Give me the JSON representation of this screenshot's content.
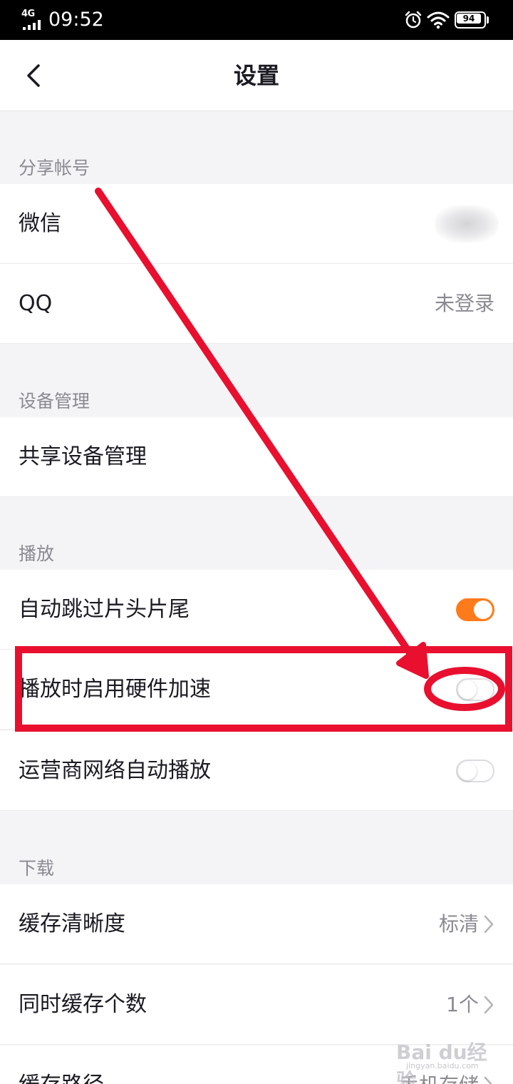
{
  "status_bar": {
    "network": "4G",
    "time": "09:52",
    "battery": "94",
    "icons": [
      "signal-icon",
      "alarm-icon",
      "wifi-icon",
      "battery-icon"
    ]
  },
  "header": {
    "title": "设置",
    "back_icon": "chevron-left-icon"
  },
  "sections": {
    "share": {
      "label": "分享帐号",
      "items": [
        {
          "label": "微信",
          "value": ""
        },
        {
          "label": "QQ",
          "value": "未登录"
        }
      ]
    },
    "device": {
      "label": "设备管理",
      "items": [
        {
          "label": "共享设备管理"
        }
      ]
    },
    "playback": {
      "label": "播放",
      "items": [
        {
          "label": "自动跳过片头片尾",
          "enabled": true
        },
        {
          "label": "播放时启用硬件加速",
          "enabled": false
        },
        {
          "label": "运营商网络自动播放",
          "enabled": false
        }
      ]
    },
    "download": {
      "label": "下载",
      "items": [
        {
          "label": "缓存清晰度",
          "value": "标清"
        },
        {
          "label": "同时缓存个数",
          "value": "1个"
        },
        {
          "label": "缓存路径",
          "value": "手机存储"
        }
      ]
    }
  },
  "colors": {
    "accent": "#ff7a1a",
    "annotation": "#e8102e",
    "background": "#f4f4f6"
  },
  "watermark": {
    "text": "Bai du经验",
    "sub": "jingyan.baidu.com"
  }
}
